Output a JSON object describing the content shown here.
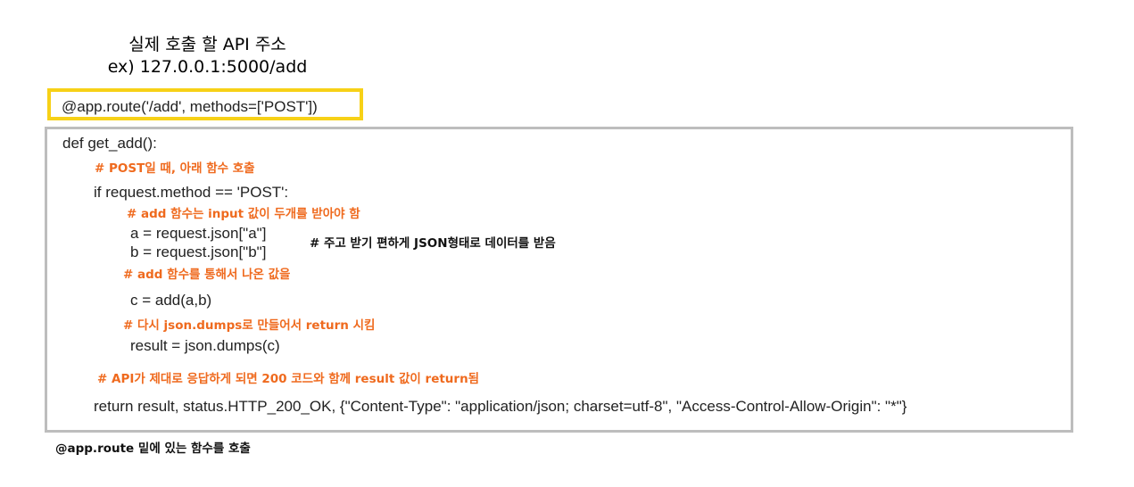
{
  "title": {
    "line1": "실제 호출 할 API 주소",
    "line2": "ex) 127.0.0.1:5000/add"
  },
  "route_decorator": "@app.route('/add', methods=['POST'])",
  "code": {
    "def_line": "def get_add():",
    "comment_post": "# POST일 때, 아래 함수 호출",
    "if_line": "if request.method == 'POST':",
    "comment_add_input": "# add 함수는 input 값이 두개를 받아야 함",
    "a_line": "a = request.json[\"a\"]",
    "b_line": "b = request.json[\"b\"]",
    "comment_json": "# 주고 받기 편하게 JSON형태로 데이터를 받음",
    "comment_add_result": "# add 함수를 통해서 나온 값을",
    "c_line": "c = add(a,b)",
    "comment_dumps": "# 다시 json.dumps로 만들어서 return 시킴",
    "result_line": "result = json.dumps(c)",
    "comment_return": "# API가 제대로 응답하게 되면 200 코드와 함께 result 값이 return됨",
    "return_line": "return result, status.HTTP_200_OK, {\"Content-Type\": \"application/json; charset=utf-8\", \"Access-Control-Allow-Origin\": \"*\"}"
  },
  "footer_note": "@app.route 밑에 있는 함수를 호출",
  "colors": {
    "highlight_border": "#f7d117",
    "code_border": "#bdbdbd",
    "comment": "#ef6a1e"
  }
}
